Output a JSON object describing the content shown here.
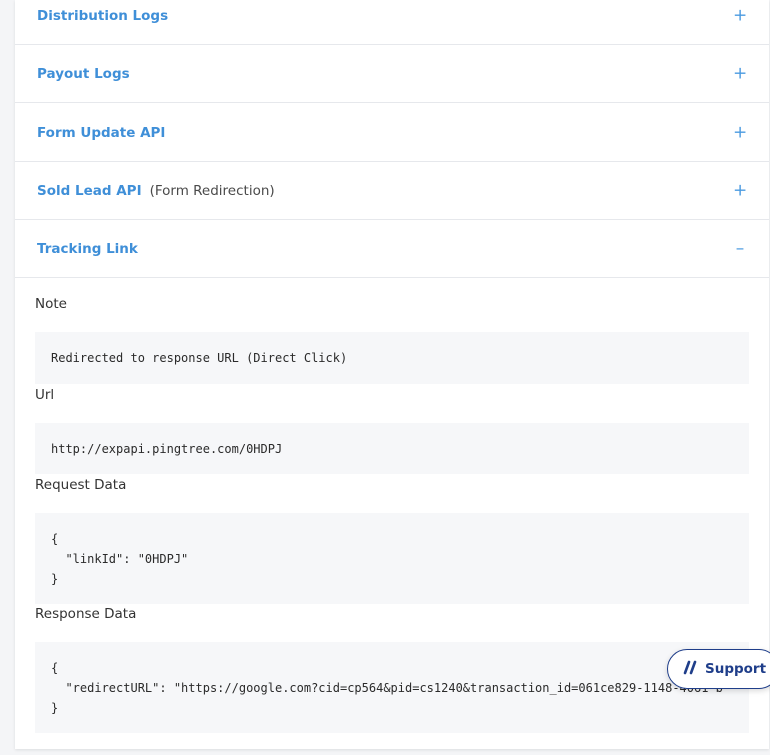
{
  "accordion": {
    "items": [
      {
        "title": "Distribution Logs",
        "subtitle": "",
        "toggle": "+"
      },
      {
        "title": "Payout Logs",
        "subtitle": "",
        "toggle": "+"
      },
      {
        "title": "Form Update API",
        "subtitle": "",
        "toggle": "+"
      },
      {
        "title": "Sold Lead API",
        "subtitle": "(Form Redirection)",
        "toggle": "+"
      },
      {
        "title": "Tracking Link",
        "subtitle": "",
        "toggle": "–"
      }
    ]
  },
  "tracking": {
    "note_label": "Note",
    "note_value": "Redirected to response URL (Direct Click)",
    "url_label": "Url",
    "url_value": "http://expapi.pingtree.com/0HDPJ",
    "request_label": "Request Data",
    "request_lines": [
      "{",
      "  \"linkId\": \"0HDPJ\"",
      "}"
    ],
    "response_label": "Response Data",
    "response_lines": [
      "{",
      "  \"redirectURL\": \"https://google.com?cid=cp564&pid=cs1240&transaction_id=061ce829-1148-4061-b",
      "}"
    ]
  },
  "support": {
    "label": "Support",
    "icon": "support-slash-icon",
    "color": "#1f3e8a"
  },
  "colors": {
    "accent": "#3f8fd8",
    "toggle": "#4a9ae0",
    "code_bg": "#f6f7f9"
  }
}
